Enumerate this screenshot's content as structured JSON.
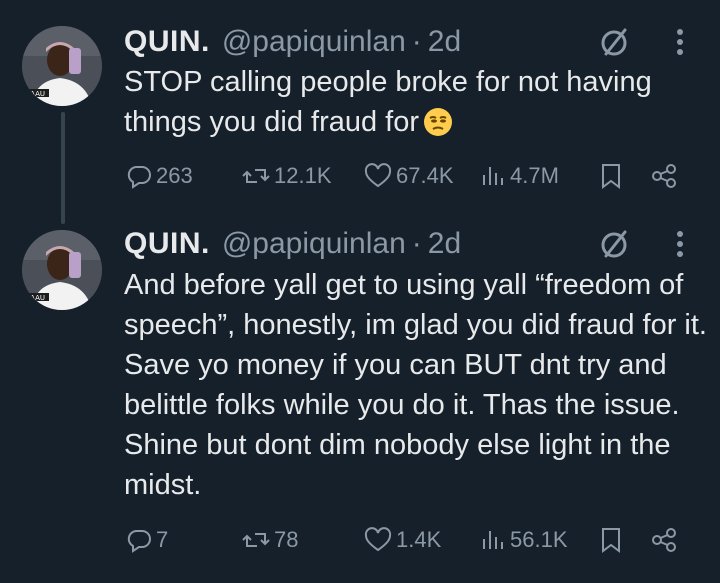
{
  "tweets": [
    {
      "name": "QUIN.",
      "handle": "@papiquinlan",
      "separator": "·",
      "time": "2d",
      "text_lines": [
        "STOP calling people broke for not having",
        "things you did fraud for"
      ],
      "emoji": "unamused-face",
      "avatar_label": "JIAAU",
      "metrics": {
        "replies": "263",
        "reposts": "12.1K",
        "likes": "67.4K",
        "views": "4.7M"
      }
    },
    {
      "name": "QUIN.",
      "handle": "@papiquinlan",
      "separator": "·",
      "time": "2d",
      "text": "And before yall get to using yall “freedom of speech”, honestly, im glad you did fraud for it. Save yo money if you can BUT dnt try and belittle folks while you do it. Thas the issue. Shine but dont dim nobody else light in the midst.",
      "avatar_label": "JIAAU",
      "metrics": {
        "replies": "7",
        "reposts": "78",
        "likes": "1.4K",
        "views": "56.1K"
      }
    }
  ],
  "icons": {
    "reply": "speech-bubble-icon",
    "repost": "repost-arrows-icon",
    "like": "heart-icon",
    "views": "bar-chart-icon",
    "bookmark": "bookmark-icon",
    "share": "share-icon",
    "grok": "grok-slash-circle-icon",
    "more": "vertical-ellipsis-icon"
  },
  "colors": {
    "background": "#15202b",
    "text": "#e7e9ea",
    "muted": "#8b98a5",
    "thread_line": "#38444d"
  }
}
